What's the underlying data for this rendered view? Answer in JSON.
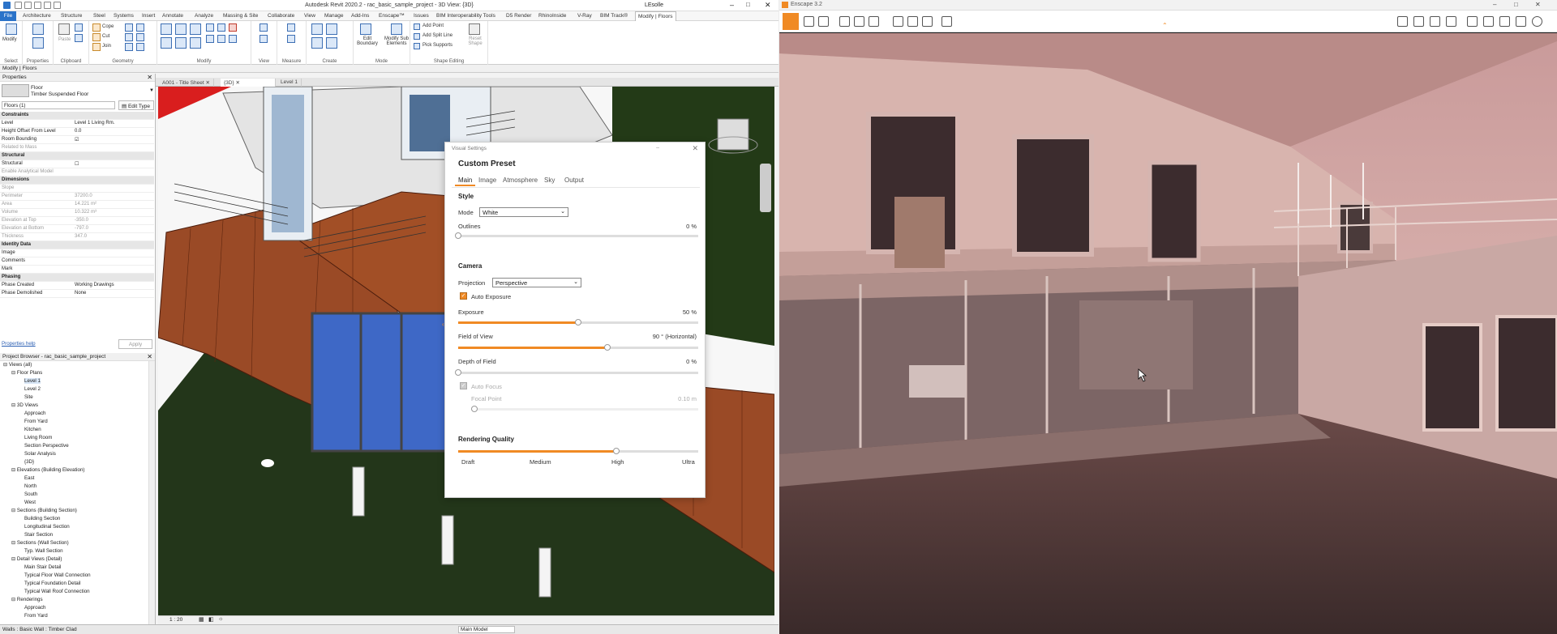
{
  "revit": {
    "title": "Autodesk Revit 2020.2 - rac_basic_sample_project - 3D View: {3D}",
    "user": "LEsolle",
    "menu": [
      "File",
      "Architecture",
      "Structure",
      "Steel",
      "Systems",
      "Insert",
      "Annotate",
      "Analyze",
      "Massing & Site",
      "Collaborate",
      "View",
      "Manage",
      "Add-Ins",
      "Enscape™",
      "Issues",
      "BIM Interoperability Tools",
      "D5 Render",
      "RhinoInside",
      "V-Ray",
      "BIM Track®",
      "Modify | Floors"
    ],
    "ribbon": {
      "groups": [
        "Select",
        "Properties",
        "Clipboard",
        "Geometry",
        "Modify",
        "View",
        "Measure",
        "Create",
        "Mode",
        "Shape Editing"
      ],
      "modify_label": "Modify",
      "paste_label": "Paste",
      "cope": "Cope",
      "cut": "Cut",
      "join": "Join",
      "edit_boundary": "Edit Boundary",
      "modify_sub": "Modify Sub Elements",
      "add_point": "Add Point",
      "add_split_line": "Add Split Line",
      "pick_supports": "Pick Supports",
      "reset_shape": "Reset Shape"
    },
    "context_bar": "Modify | Floors",
    "properties": {
      "header": "Properties",
      "type_family": "Floor",
      "type_name": "Timber Suspended Floor",
      "selector": "Floors (1)",
      "edit_type": "Edit Type",
      "rows": [
        {
          "k": "Constraints",
          "v": "",
          "sec": true
        },
        {
          "k": "Level",
          "v": "Level 1 Living Rm."
        },
        {
          "k": "Height Offset From Level",
          "v": "0.0"
        },
        {
          "k": "Room Bounding",
          "v": "☑"
        },
        {
          "k": "Related to Mass",
          "v": "",
          "dim": true
        },
        {
          "k": "Structural",
          "v": "",
          "sec": true
        },
        {
          "k": "Structural",
          "v": "☐"
        },
        {
          "k": "Enable Analytical Model",
          "v": "",
          "dim": true
        },
        {
          "k": "Dimensions",
          "v": "",
          "sec": true
        },
        {
          "k": "Slope",
          "v": "",
          "dim": true
        },
        {
          "k": "Perimeter",
          "v": "37200.0",
          "dim": true
        },
        {
          "k": "Area",
          "v": "14.221 m²",
          "dim": true
        },
        {
          "k": "Volume",
          "v": "10.322 m³",
          "dim": true
        },
        {
          "k": "Elevation at Top",
          "v": "-350.0",
          "dim": true
        },
        {
          "k": "Elevation at Bottom",
          "v": "-797.0",
          "dim": true
        },
        {
          "k": "Thickness",
          "v": "347.0",
          "dim": true
        },
        {
          "k": "Identity Data",
          "v": "",
          "sec": true
        },
        {
          "k": "Image",
          "v": ""
        },
        {
          "k": "Comments",
          "v": ""
        },
        {
          "k": "Mark",
          "v": ""
        },
        {
          "k": "Phasing",
          "v": "",
          "sec": true
        },
        {
          "k": "Phase Created",
          "v": "Working Drawings"
        },
        {
          "k": "Phase Demolished",
          "v": "None"
        }
      ],
      "help": "Properties help",
      "apply": "Apply"
    },
    "browser": {
      "header": "Project Browser - rac_basic_sample_project",
      "items": [
        {
          "t": "Views (all)",
          "l": 0
        },
        {
          "t": "Floor Plans",
          "l": 1
        },
        {
          "t": "Level 1",
          "l": 2
        },
        {
          "t": "Level 2",
          "l": 2
        },
        {
          "t": "Site",
          "l": 2
        },
        {
          "t": "3D Views",
          "l": 1
        },
        {
          "t": "Approach",
          "l": 2
        },
        {
          "t": "From Yard",
          "l": 2
        },
        {
          "t": "Kitchen",
          "l": 2
        },
        {
          "t": "Living Room",
          "l": 2
        },
        {
          "t": "Section Perspective",
          "l": 2
        },
        {
          "t": "Solar Analysis",
          "l": 2
        },
        {
          "t": "{3D}",
          "l": 2
        },
        {
          "t": "Elevations (Building Elevation)",
          "l": 1
        },
        {
          "t": "East",
          "l": 2
        },
        {
          "t": "North",
          "l": 2
        },
        {
          "t": "South",
          "l": 2
        },
        {
          "t": "West",
          "l": 2
        },
        {
          "t": "Sections (Building Section)",
          "l": 1
        },
        {
          "t": "Building Section",
          "l": 2
        },
        {
          "t": "Longitudinal Section",
          "l": 2
        },
        {
          "t": "Stair Section",
          "l": 2
        },
        {
          "t": "Sections (Wall Section)",
          "l": 1
        },
        {
          "t": "Typ. Wall Section",
          "l": 2
        },
        {
          "t": "Detail Views (Detail)",
          "l": 1
        },
        {
          "t": "Main Stair Detail",
          "l": 2
        },
        {
          "t": "Typical Floor Wall Connection",
          "l": 2
        },
        {
          "t": "Typical Foundation Detail",
          "l": 2
        },
        {
          "t": "Typical Wall Roof Connection",
          "l": 2
        },
        {
          "t": "Renderings",
          "l": 1
        },
        {
          "t": "Approach",
          "l": 2
        },
        {
          "t": "From Yard",
          "l": 2
        }
      ]
    },
    "view_tabs": [
      "A001 - Title Sheet",
      "{3D}",
      "Level 1"
    ],
    "scale": "1 : 20",
    "model": "Main Model",
    "status": "Walls : Basic Wall : Timber Clad"
  },
  "visual_settings": {
    "window_title": "Visual Settings",
    "preset": "Custom Preset",
    "tabs": [
      "Main",
      "Image",
      "Atmosphere",
      "Sky",
      "Output"
    ],
    "style_heading": "Style",
    "mode_label": "Mode",
    "mode_value": "White",
    "outlines_label": "Outlines",
    "outlines_value": "0 %",
    "outlines_pct": 0,
    "camera_heading": "Camera",
    "projection_label": "Projection",
    "projection_value": "Perspective",
    "auto_exposure": "Auto Exposure",
    "exposure_label": "Exposure",
    "exposure_value": "50 %",
    "exposure_pct": 50,
    "fov_label": "Field of View",
    "fov_value": "90 ° (Horizontal)",
    "fov_pct": 62,
    "dof_label": "Depth of Field",
    "dof_value": "0 %",
    "dof_pct": 0,
    "auto_focus": "Auto Focus",
    "focal_label": "Focal Point",
    "focal_value": "0.10 m",
    "quality_heading": "Rendering Quality",
    "quality_levels": [
      "Draft",
      "Medium",
      "High",
      "Ultra"
    ],
    "quality_pct": 66
  },
  "enscape": {
    "title": "Enscape 3.2",
    "colors": {
      "accent": "#f08a24",
      "revit_blue": "#2b73c9"
    }
  }
}
